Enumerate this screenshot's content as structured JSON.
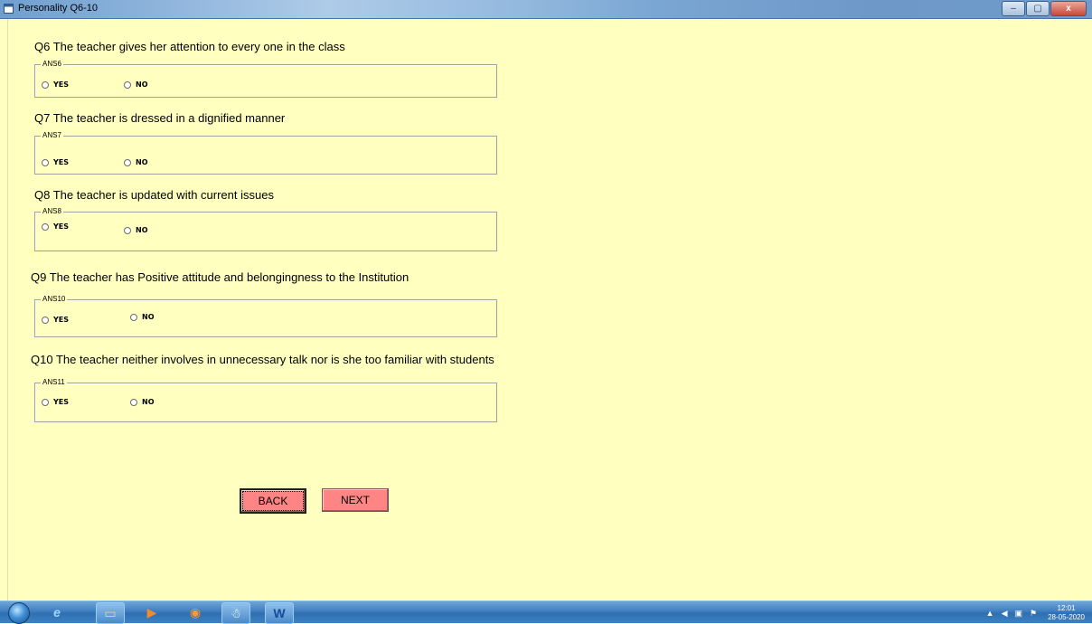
{
  "window": {
    "title": "Personality Q6-10",
    "min_icon": "minimize-icon",
    "max_icon": "maximize-icon",
    "close_icon": "close-icon",
    "min_glyph": "–",
    "max_glyph": "▢",
    "close_glyph": "x"
  },
  "questions": [
    {
      "text": "Q6  The teacher gives her attention to every one in the class",
      "group": "ANS6",
      "yes": "YES",
      "no": "NO"
    },
    {
      "text": "Q7  The  teacher is dressed in a dignified manner",
      "group": "ANS7",
      "yes": "YES",
      "no": "NO"
    },
    {
      "text": "Q8  The teacher is updated with current issues",
      "group": "ANS8",
      "yes": "YES",
      "no": "NO"
    },
    {
      "text": "Q9  The teacher has Positive attitude and belongingness to the Institution",
      "group": "ANS10",
      "yes": "YES",
      "no": "NO"
    },
    {
      "text": "Q10  The teacher neither involves in unnecessary talk nor is she too familiar with students",
      "group": "ANS11",
      "yes": "YES",
      "no": "NO"
    }
  ],
  "buttons": {
    "back": "BACK",
    "next": "NEXT",
    "color": "#ff8484"
  },
  "taskbar": {
    "start_icon": "windows-start-icon",
    "items": [
      "ie-icon",
      "explorer-icon",
      "media-player-icon",
      "firefox-icon",
      "app-icon",
      "word-icon"
    ],
    "glyphs": {
      "ie": "e",
      "explorer": "▭",
      "media": "▶",
      "firefox": "◉",
      "app": "☃",
      "word": "W"
    },
    "tray": {
      "up": "▲",
      "volume": "◀",
      "network": "▣",
      "flag": "⚑"
    },
    "clock_time": "12:01",
    "clock_date": "28-05-2020"
  },
  "colors": {
    "background": "#ffffc0",
    "button": "#ff8484"
  }
}
